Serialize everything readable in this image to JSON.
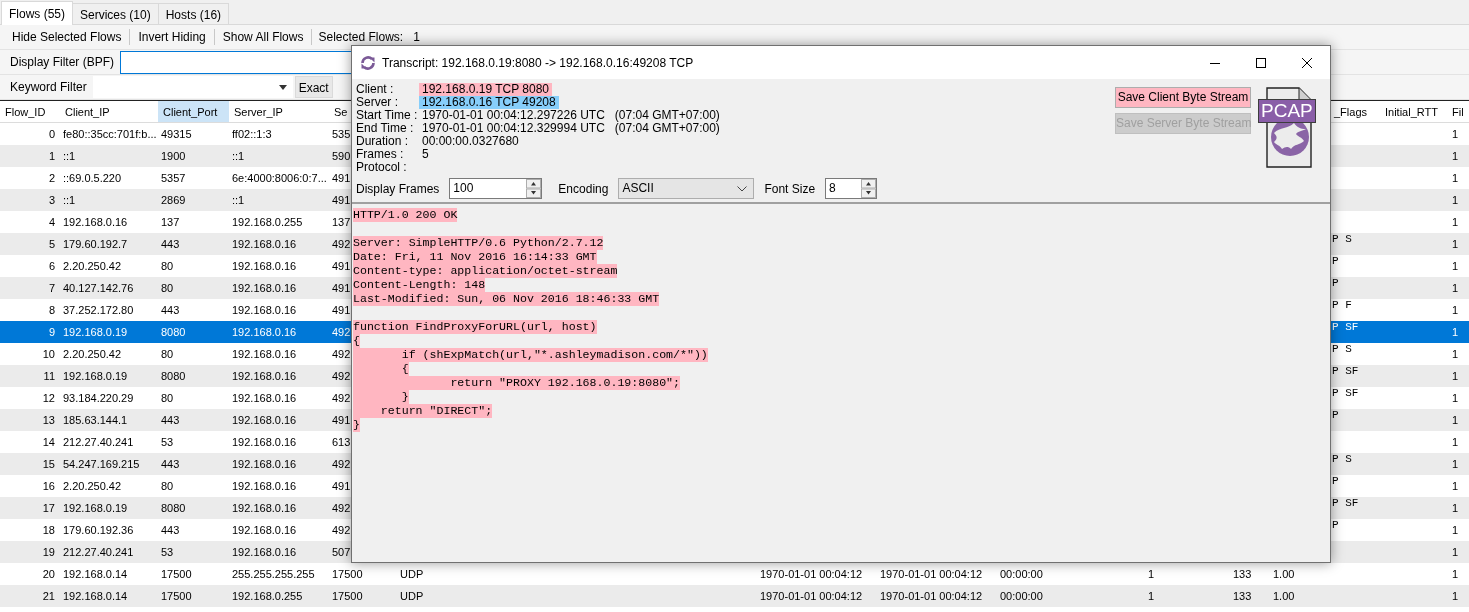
{
  "tabs": [
    {
      "label": "Flows (55)",
      "selected": true
    },
    {
      "label": "Services (10)",
      "selected": false
    },
    {
      "label": "Hosts (16)",
      "selected": false
    }
  ],
  "toolbar": {
    "actions": [
      "Hide Selected Flows",
      "Invert Hiding",
      "Show All Flows"
    ],
    "selected_flows": {
      "label": "Selected Flows:",
      "value": "1"
    },
    "display_filter": {
      "label": "Display Filter (BPF)",
      "focused": true
    },
    "keyword_filter": {
      "label": "Keyword Filter",
      "button": "Exact"
    }
  },
  "table": {
    "columns": [
      {
        "label": "Flow_ID",
        "selected": false
      },
      {
        "label": "Client_IP",
        "selected": false
      },
      {
        "label": "Client_Port",
        "selected": true
      },
      {
        "label": "Server_IP",
        "selected": false
      },
      {
        "label": "Se",
        "selected": false
      },
      null,
      null,
      null,
      null,
      null,
      null,
      null,
      {
        "label": "_Flags",
        "selected": false
      },
      {
        "label": "Initial_RTT",
        "selected": false
      },
      {
        "label": "Fil",
        "selected": false
      }
    ],
    "rows": [
      {
        "selected": false,
        "cells": [
          "0",
          "fe80::35cc:701f:b...",
          "49315",
          "ff02::1:3",
          "535",
          null,
          null,
          null,
          null,
          null,
          null,
          null,
          null,
          null,
          "1"
        ]
      },
      {
        "selected": false,
        "cells": [
          "1",
          "::1",
          "1900",
          "::1",
          "590",
          null,
          null,
          null,
          null,
          null,
          null,
          null,
          null,
          null,
          "1"
        ]
      },
      {
        "selected": false,
        "cells": [
          "2",
          "::69.0.5.220",
          "5357",
          "6e:4000:8006:0:7...",
          "491",
          null,
          null,
          null,
          null,
          null,
          null,
          null,
          null,
          null,
          "1"
        ]
      },
      {
        "selected": false,
        "cells": [
          "3",
          "::1",
          "2869",
          "::1",
          "491",
          null,
          null,
          null,
          null,
          null,
          null,
          null,
          null,
          null,
          "1"
        ]
      },
      {
        "selected": false,
        "cells": [
          "4",
          "192.168.0.16",
          "137",
          "192.168.0.255",
          "137",
          null,
          null,
          null,
          null,
          null,
          null,
          null,
          null,
          null,
          "1"
        ]
      },
      {
        "selected": false,
        "cells": [
          "5",
          "179.60.192.7",
          "443",
          "192.168.0.16",
          "492",
          null,
          null,
          null,
          null,
          null,
          null,
          null,
          "P S",
          null,
          "1"
        ]
      },
      {
        "selected": false,
        "cells": [
          "6",
          "2.20.250.42",
          "80",
          "192.168.0.16",
          "491",
          null,
          null,
          null,
          null,
          null,
          null,
          null,
          "P",
          null,
          "1"
        ]
      },
      {
        "selected": false,
        "cells": [
          "7",
          "40.127.142.76",
          "80",
          "192.168.0.16",
          "491",
          null,
          null,
          null,
          null,
          null,
          null,
          null,
          "P",
          null,
          "1"
        ]
      },
      {
        "selected": false,
        "cells": [
          "8",
          "37.252.172.80",
          "443",
          "192.168.0.16",
          "491",
          null,
          null,
          null,
          null,
          null,
          null,
          null,
          "P  F",
          null,
          "1"
        ]
      },
      {
        "selected": true,
        "cells": [
          "9",
          "192.168.0.19",
          "8080",
          "192.168.0.16",
          "492",
          null,
          null,
          null,
          null,
          null,
          null,
          null,
          "P SF",
          null,
          "1"
        ]
      },
      {
        "selected": false,
        "cells": [
          "10",
          "2.20.250.42",
          "80",
          "192.168.0.16",
          "492",
          null,
          null,
          null,
          null,
          null,
          null,
          null,
          "P S",
          null,
          "1"
        ]
      },
      {
        "selected": false,
        "cells": [
          "11",
          "192.168.0.19",
          "8080",
          "192.168.0.16",
          "492",
          null,
          null,
          null,
          null,
          null,
          null,
          null,
          "P SF",
          null,
          "1"
        ]
      },
      {
        "selected": false,
        "cells": [
          "12",
          "93.184.220.29",
          "80",
          "192.168.0.16",
          "492",
          null,
          null,
          null,
          null,
          null,
          null,
          null,
          "P SF",
          null,
          "1"
        ]
      },
      {
        "selected": false,
        "cells": [
          "13",
          "185.63.144.1",
          "443",
          "192.168.0.16",
          "491",
          null,
          null,
          null,
          null,
          null,
          null,
          null,
          "P",
          null,
          "1"
        ]
      },
      {
        "selected": false,
        "cells": [
          "14",
          "212.27.40.241",
          "53",
          "192.168.0.16",
          "613",
          null,
          null,
          null,
          null,
          null,
          null,
          null,
          null,
          null,
          "1"
        ]
      },
      {
        "selected": false,
        "cells": [
          "15",
          "54.247.169.215",
          "443",
          "192.168.0.16",
          "492",
          null,
          null,
          null,
          null,
          null,
          null,
          null,
          "P S",
          null,
          "1"
        ]
      },
      {
        "selected": false,
        "cells": [
          "16",
          "2.20.250.42",
          "80",
          "192.168.0.16",
          "491",
          null,
          null,
          null,
          null,
          null,
          null,
          null,
          "P",
          null,
          "1"
        ]
      },
      {
        "selected": false,
        "cells": [
          "17",
          "192.168.0.19",
          "8080",
          "192.168.0.16",
          "492",
          null,
          null,
          null,
          null,
          null,
          null,
          null,
          "P SF",
          null,
          "1"
        ]
      },
      {
        "selected": false,
        "cells": [
          "18",
          "179.60.192.36",
          "443",
          "192.168.0.16",
          "492",
          null,
          null,
          null,
          null,
          null,
          null,
          null,
          "P",
          null,
          "1"
        ]
      },
      {
        "selected": false,
        "cells": [
          "19",
          "212.27.40.241",
          "53",
          "192.168.0.16",
          "507",
          null,
          null,
          null,
          null,
          null,
          null,
          null,
          null,
          null,
          "1"
        ]
      },
      {
        "selected": false,
        "cells": [
          "20",
          "192.168.0.14",
          "17500",
          "255.255.255.255",
          "17500",
          "UDP",
          "1970-01-01 00:04:12",
          "1970-01-01 00:04:12",
          "00:00:00",
          "1",
          "133",
          "1.00",
          null,
          null,
          "1"
        ]
      },
      {
        "selected": false,
        "cells": [
          "21",
          "192.168.0.14",
          "17500",
          "192.168.0.255",
          "17500",
          "UDP",
          "1970-01-01 00:04:12",
          "1970-01-01 00:04:12",
          "00:00:00",
          "1",
          "133",
          "1.00",
          null,
          null,
          "1"
        ]
      }
    ]
  },
  "transcript": {
    "title": "Transcript: 192.168.0.19:8080 -> 192.168.0.16:49208 TCP",
    "info": [
      {
        "label": "Client :",
        "value": "192.168.0.19 TCP 8080",
        "color": "#ffb6c1"
      },
      {
        "label": "Server :",
        "value": "192.168.0.16 TCP 49208",
        "color": "#87cefa"
      },
      {
        "label": "Start Time :",
        "value": "1970-01-01 00:04:12.297226 UTC",
        "note": "(07:04 GMT+07:00)"
      },
      {
        "label": "End Time :",
        "value": "1970-01-01 00:04:12.329994 UTC",
        "note": "(07:04 GMT+07:00)"
      },
      {
        "label": "Duration :",
        "value": "00:00:00.0327680"
      },
      {
        "label": "Frames :",
        "value": "5"
      },
      {
        "label": "Protocol :"
      }
    ],
    "buttons": [
      {
        "label": "Save Client Byte Stream",
        "disabled": false,
        "color": "#ffb6c1"
      },
      {
        "label": "Save Server Byte Stream",
        "disabled": true
      }
    ],
    "file_badge": "PCAP",
    "controls": [
      {
        "kind": "spin",
        "label": "Display Frames",
        "value": "100"
      },
      {
        "kind": "select",
        "label": "Encoding",
        "value": "ASCII"
      },
      {
        "kind": "spin",
        "label": "Font Size",
        "value": "8"
      }
    ],
    "blocks": [
      {
        "color": "#ffb6c1",
        "lines": [
          "HTTP/1.0 200 OK"
        ]
      },
      {
        "color": "#ffb6c1",
        "lines": [
          "Server: SimpleHTTP/0.6 Python/2.7.12",
          "Date: Fri, 11 Nov 2016 16:14:33 GMT",
          "Content-type: application/octet-stream",
          "Content-Length: 148",
          "Last-Modified: Sun, 06 Nov 2016 18:46:33 GMT"
        ]
      },
      {
        "color": "#ffb6c1",
        "lines": [
          "function FindProxyForURL(url, host)",
          "{",
          "\tif (shExpMatch(url,\"*.ashleymadison.com/*\"))",
          "\t{",
          "\t\treturn \"PROXY 192.168.0.19:8080\";",
          "\t}",
          "    return \"DIRECT\";",
          "}"
        ]
      }
    ]
  }
}
